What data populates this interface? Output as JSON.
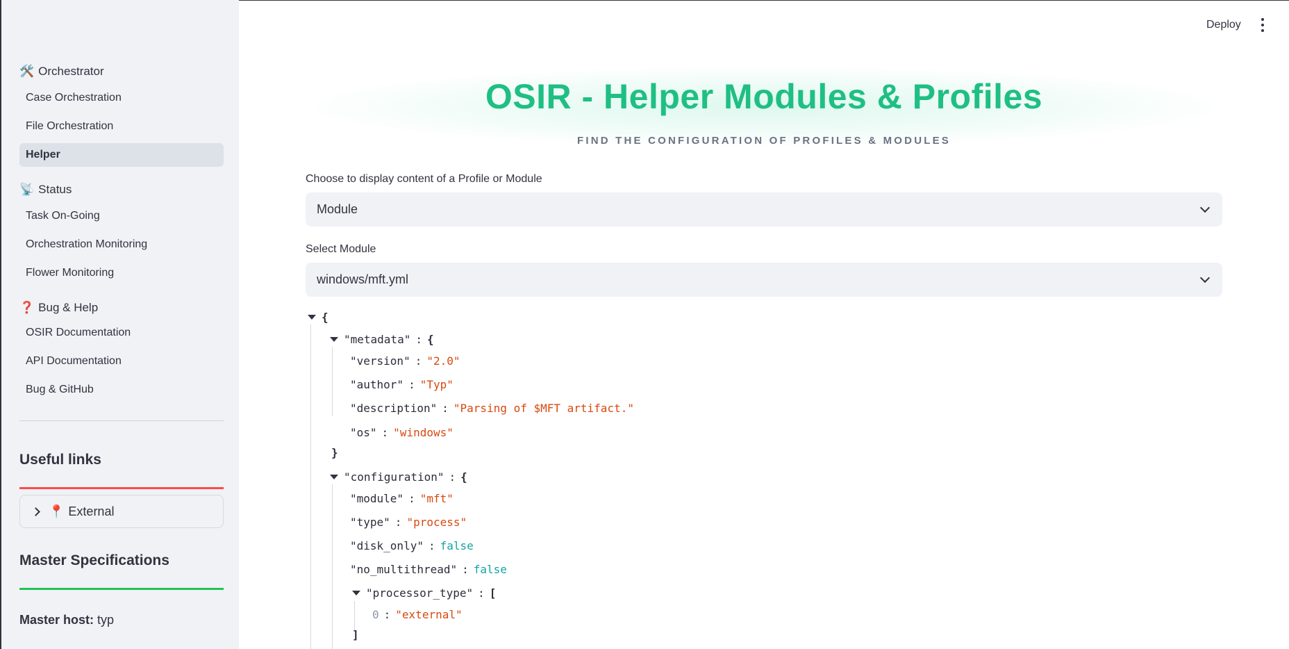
{
  "sidebar": {
    "sections": [
      {
        "emoji": "🛠️",
        "label": "Orchestrator"
      },
      {
        "emoji": "📡",
        "label": "Status"
      },
      {
        "emoji": "❓",
        "label": "Bug & Help"
      }
    ],
    "items": [
      {
        "label": "Case Orchestration",
        "active": false
      },
      {
        "label": "File Orchestration",
        "active": false
      },
      {
        "label": "Helper",
        "active": true
      },
      {
        "label": "Task On-Going",
        "active": false
      },
      {
        "label": "Orchestration Monitoring",
        "active": false
      },
      {
        "label": "Flower Monitoring",
        "active": false
      },
      {
        "label": "OSIR Documentation",
        "active": false
      },
      {
        "label": "API Documentation",
        "active": false
      },
      {
        "label": "Bug & GitHub",
        "active": false
      }
    ],
    "useful_links_heading": "Useful links",
    "external_expander": {
      "emoji": "📍",
      "label": "External"
    },
    "master_spec_heading": "Master Specifications",
    "master_host": {
      "label": "Master host:",
      "value": "typ"
    }
  },
  "header": {
    "deploy_label": "Deploy"
  },
  "main": {
    "title": "OSIR - Helper Modules & Profiles",
    "subtitle": "FIND THE CONFIGURATION OF PROFILES & MODULES",
    "type_select": {
      "label": "Choose to display content of a Profile or Module",
      "value": "Module"
    },
    "module_select": {
      "label": "Select Module",
      "value": "windows/mft.yml"
    },
    "json_view": {
      "root_open": "{",
      "metadata_key": "\"metadata\"",
      "metadata_open": "{",
      "metadata_close": "}",
      "version": {
        "key": "\"version\"",
        "value": "\"2.0\""
      },
      "author": {
        "key": "\"author\"",
        "value": "\"Typ\""
      },
      "description": {
        "key": "\"description\"",
        "value": "\"Parsing of $MFT artifact.\""
      },
      "os": {
        "key": "\"os\"",
        "value": "\"windows\""
      },
      "configuration_key": "\"configuration\"",
      "configuration_open": "{",
      "module": {
        "key": "\"module\"",
        "value": "\"mft\""
      },
      "type": {
        "key": "\"type\"",
        "value": "\"process\""
      },
      "disk_only": {
        "key": "\"disk_only\"",
        "value": "false"
      },
      "no_multithread": {
        "key": "\"no_multithread\"",
        "value": "false"
      },
      "processor_type_key": "\"processor_type\"",
      "processor_type_open": "[",
      "processor_type_0": {
        "index": "0",
        "value": "\"external\""
      },
      "processor_type_close": "]",
      "colon": ":"
    }
  },
  "colors": {
    "title_green": "#1fbf84",
    "string_value": "#d9480f",
    "boolean_value": "#12a5a0",
    "active_nav_bg": "#dde1e8",
    "sidebar_bg": "#f0f2f6",
    "red_bar": "#ff4b4b",
    "green_bar": "#21c354"
  }
}
